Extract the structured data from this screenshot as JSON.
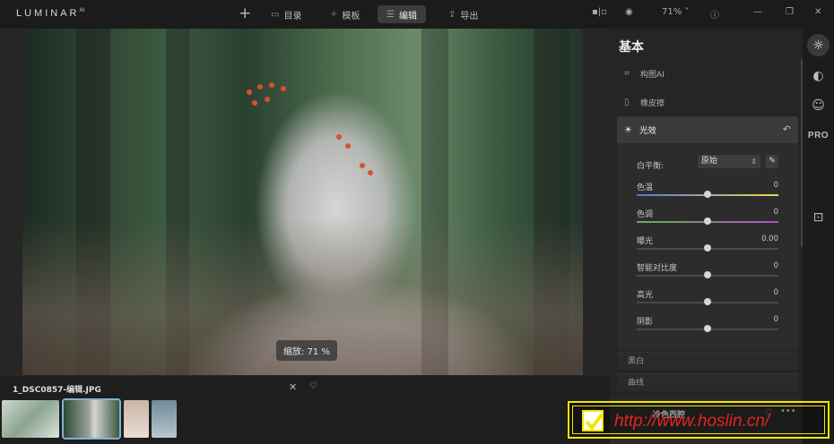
{
  "app": {
    "logo": "LUMINAR",
    "logo_sup": "AI"
  },
  "topbar": {
    "add_label": "+",
    "tabs": [
      {
        "label": "目录",
        "icon": "folder-icon"
      },
      {
        "label": "模板",
        "icon": "magic-wand-icon"
      },
      {
        "label": "编辑",
        "icon": "sliders-icon"
      },
      {
        "label": "导出",
        "icon": "export-icon"
      }
    ],
    "zoom_label": "71%"
  },
  "canvas": {
    "zoom_badge": "缩放: 71 %"
  },
  "panel": {
    "title": "基本",
    "tools": [
      {
        "label": "构图AI",
        "icon": "crop-icon"
      },
      {
        "label": "橡皮擦",
        "icon": "eraser-icon"
      }
    ],
    "light": {
      "label": "光效",
      "white_balance_label": "白平衡:",
      "white_balance_value": "原始",
      "sliders": [
        {
          "label": "色温",
          "value": "0",
          "level": 0.5
        },
        {
          "label": "色调",
          "value": "0",
          "level": 0.5
        },
        {
          "label": "曝光",
          "value": "0.00",
          "level": 0.5
        },
        {
          "label": "智能对比度",
          "value": "0",
          "level": 0.5
        },
        {
          "label": "高光",
          "value": "0",
          "level": 0.5
        },
        {
          "label": "阴影",
          "value": "0",
          "level": 0.5
        }
      ]
    },
    "sections": [
      "黑白",
      "曲线"
    ]
  },
  "filmstrip": {
    "filename": "1_DSC0857-编辑.JPG"
  },
  "looks": {
    "name": "冷色西腔"
  },
  "watermark": {
    "text": "http://www.hoslin.cn/"
  },
  "colors": {
    "accent_thumb": "#7fb3d5",
    "watermark_yellow": "#f2e600",
    "watermark_red": "#e3261d"
  }
}
